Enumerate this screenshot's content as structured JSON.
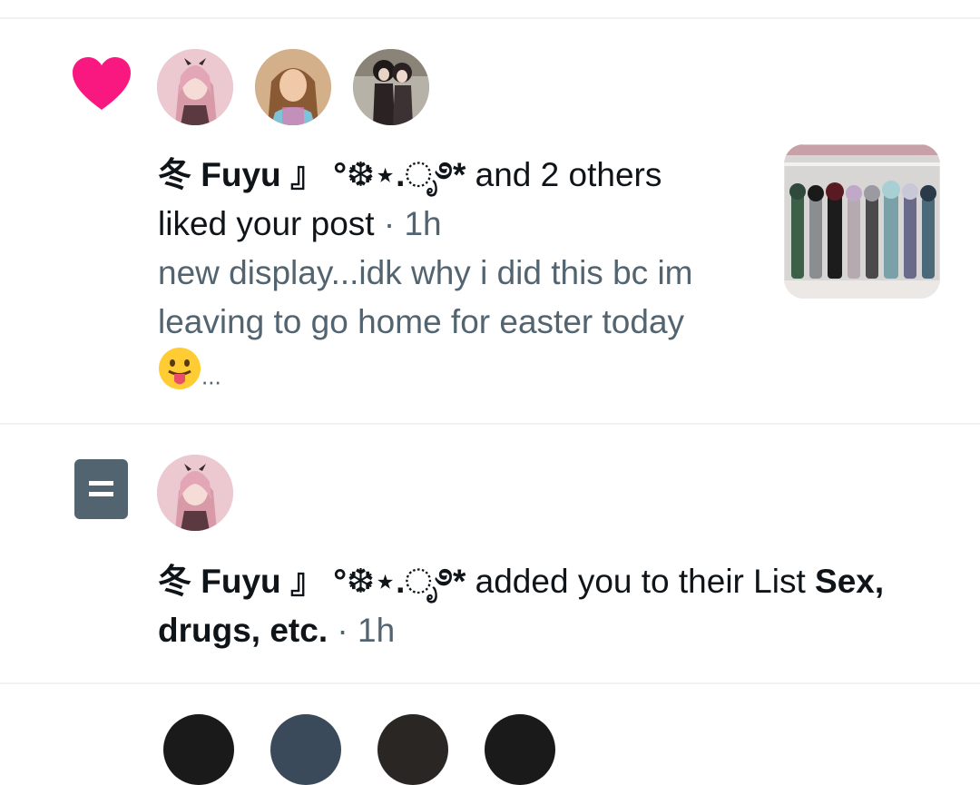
{
  "notifications": [
    {
      "type": "like",
      "icon": "heart-icon",
      "icon_color": "#f91880",
      "actor_name": "冬 Fuyu 』 °❆⋆.ೃ࿔*",
      "action_text": " and 2 others",
      "action_text_2": "liked your post",
      "separator": " · ",
      "time": "1h",
      "post_preview_line1": "new display...idk why i did this bc im",
      "post_preview_line2": "leaving to go home for easter today",
      "post_preview_ellipsis": "...",
      "emoji": "face-with-tongue-emoji"
    },
    {
      "type": "list_add",
      "icon": "list-icon",
      "icon_color": "#536471",
      "actor_name": "冬 Fuyu 』 °❆⋆.ೃ࿔*",
      "action_text": " added you to their List ",
      "list_name_part1": "Sex,",
      "list_name_part2": "drugs, etc.",
      "separator": " · ",
      "time": "1h"
    }
  ],
  "colors": {
    "accent_like": "#f91880",
    "muted_text": "#536471",
    "divider": "#eff3f4"
  }
}
